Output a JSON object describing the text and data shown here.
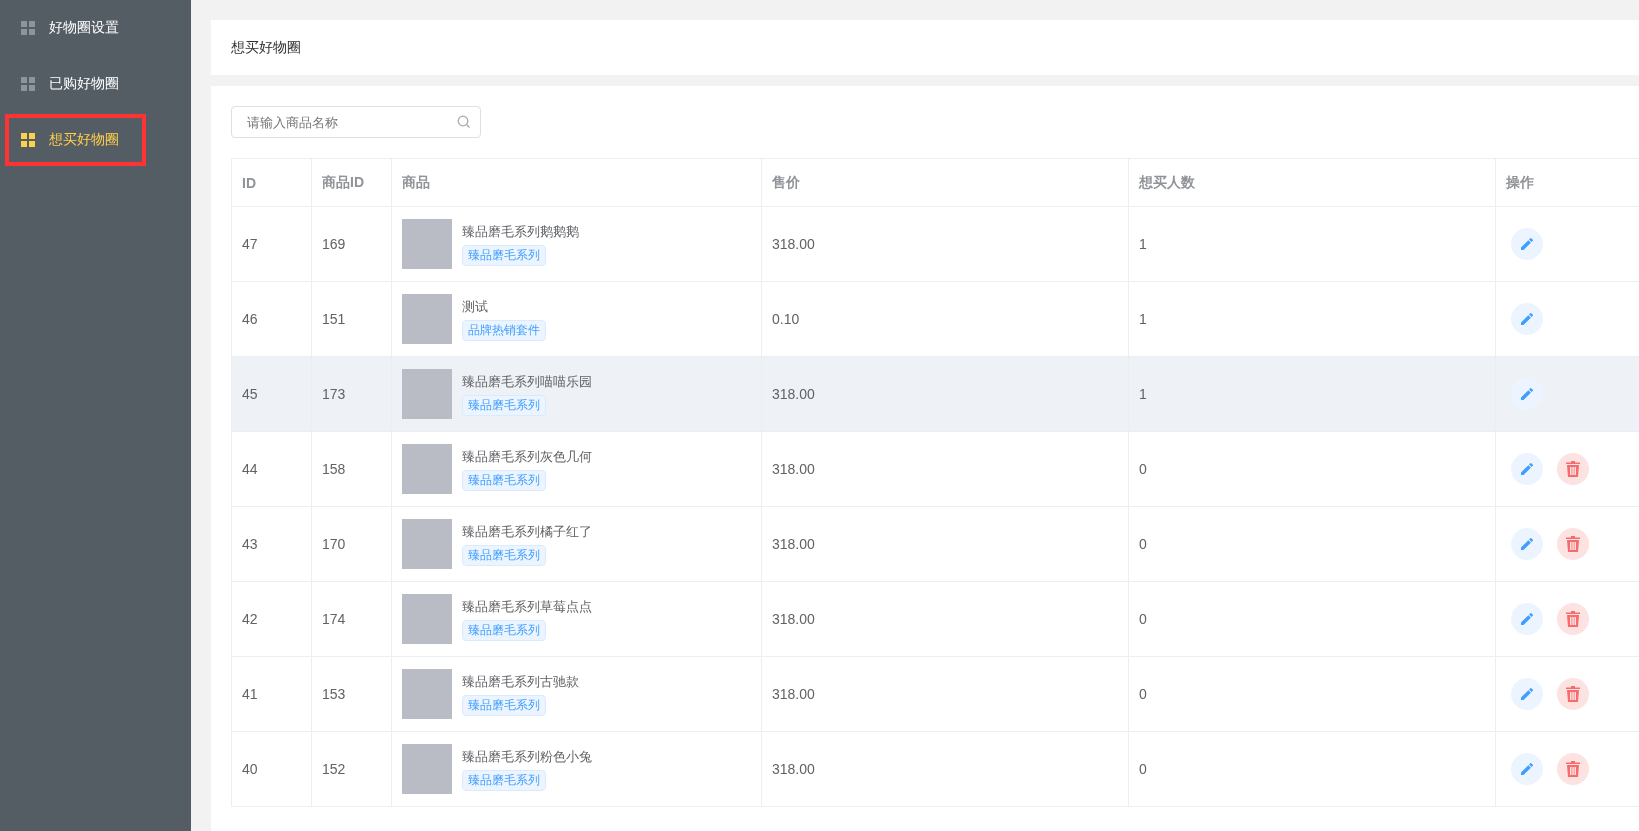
{
  "sidebar": {
    "items": [
      {
        "label": "好物圈设置",
        "selected": false
      },
      {
        "label": "已购好物圈",
        "selected": false
      },
      {
        "label": "想买好物圈",
        "selected": true
      }
    ]
  },
  "header": {
    "title": "想买好物圈"
  },
  "search": {
    "placeholder": "请输入商品名称"
  },
  "table": {
    "columns": [
      "ID",
      "商品ID",
      "商品",
      "售价",
      "想买人数",
      "操作"
    ],
    "rows": [
      {
        "id": "47",
        "goods_id": "169",
        "name": "臻品磨毛系列鹅鹅鹅",
        "tag": "臻品磨毛系列",
        "price": "318.00",
        "count": "1",
        "highlighted": false,
        "deletable": false
      },
      {
        "id": "46",
        "goods_id": "151",
        "name": "测试",
        "tag": "品牌热销套件",
        "price": "0.10",
        "count": "1",
        "highlighted": false,
        "deletable": false
      },
      {
        "id": "45",
        "goods_id": "173",
        "name": "臻品磨毛系列喵喵乐园",
        "tag": "臻品磨毛系列",
        "price": "318.00",
        "count": "1",
        "highlighted": true,
        "deletable": false
      },
      {
        "id": "44",
        "goods_id": "158",
        "name": "臻品磨毛系列灰色几何",
        "tag": "臻品磨毛系列",
        "price": "318.00",
        "count": "0",
        "highlighted": false,
        "deletable": true
      },
      {
        "id": "43",
        "goods_id": "170",
        "name": "臻品磨毛系列橘子红了",
        "tag": "臻品磨毛系列",
        "price": "318.00",
        "count": "0",
        "highlighted": false,
        "deletable": true
      },
      {
        "id": "42",
        "goods_id": "174",
        "name": "臻品磨毛系列草莓点点",
        "tag": "臻品磨毛系列",
        "price": "318.00",
        "count": "0",
        "highlighted": false,
        "deletable": true
      },
      {
        "id": "41",
        "goods_id": "153",
        "name": "臻品磨毛系列古驰款",
        "tag": "臻品磨毛系列",
        "price": "318.00",
        "count": "0",
        "highlighted": false,
        "deletable": true
      },
      {
        "id": "40",
        "goods_id": "152",
        "name": "臻品磨毛系列粉色小兔",
        "tag": "臻品磨毛系列",
        "price": "318.00",
        "count": "0",
        "highlighted": false,
        "deletable": true
      }
    ]
  }
}
